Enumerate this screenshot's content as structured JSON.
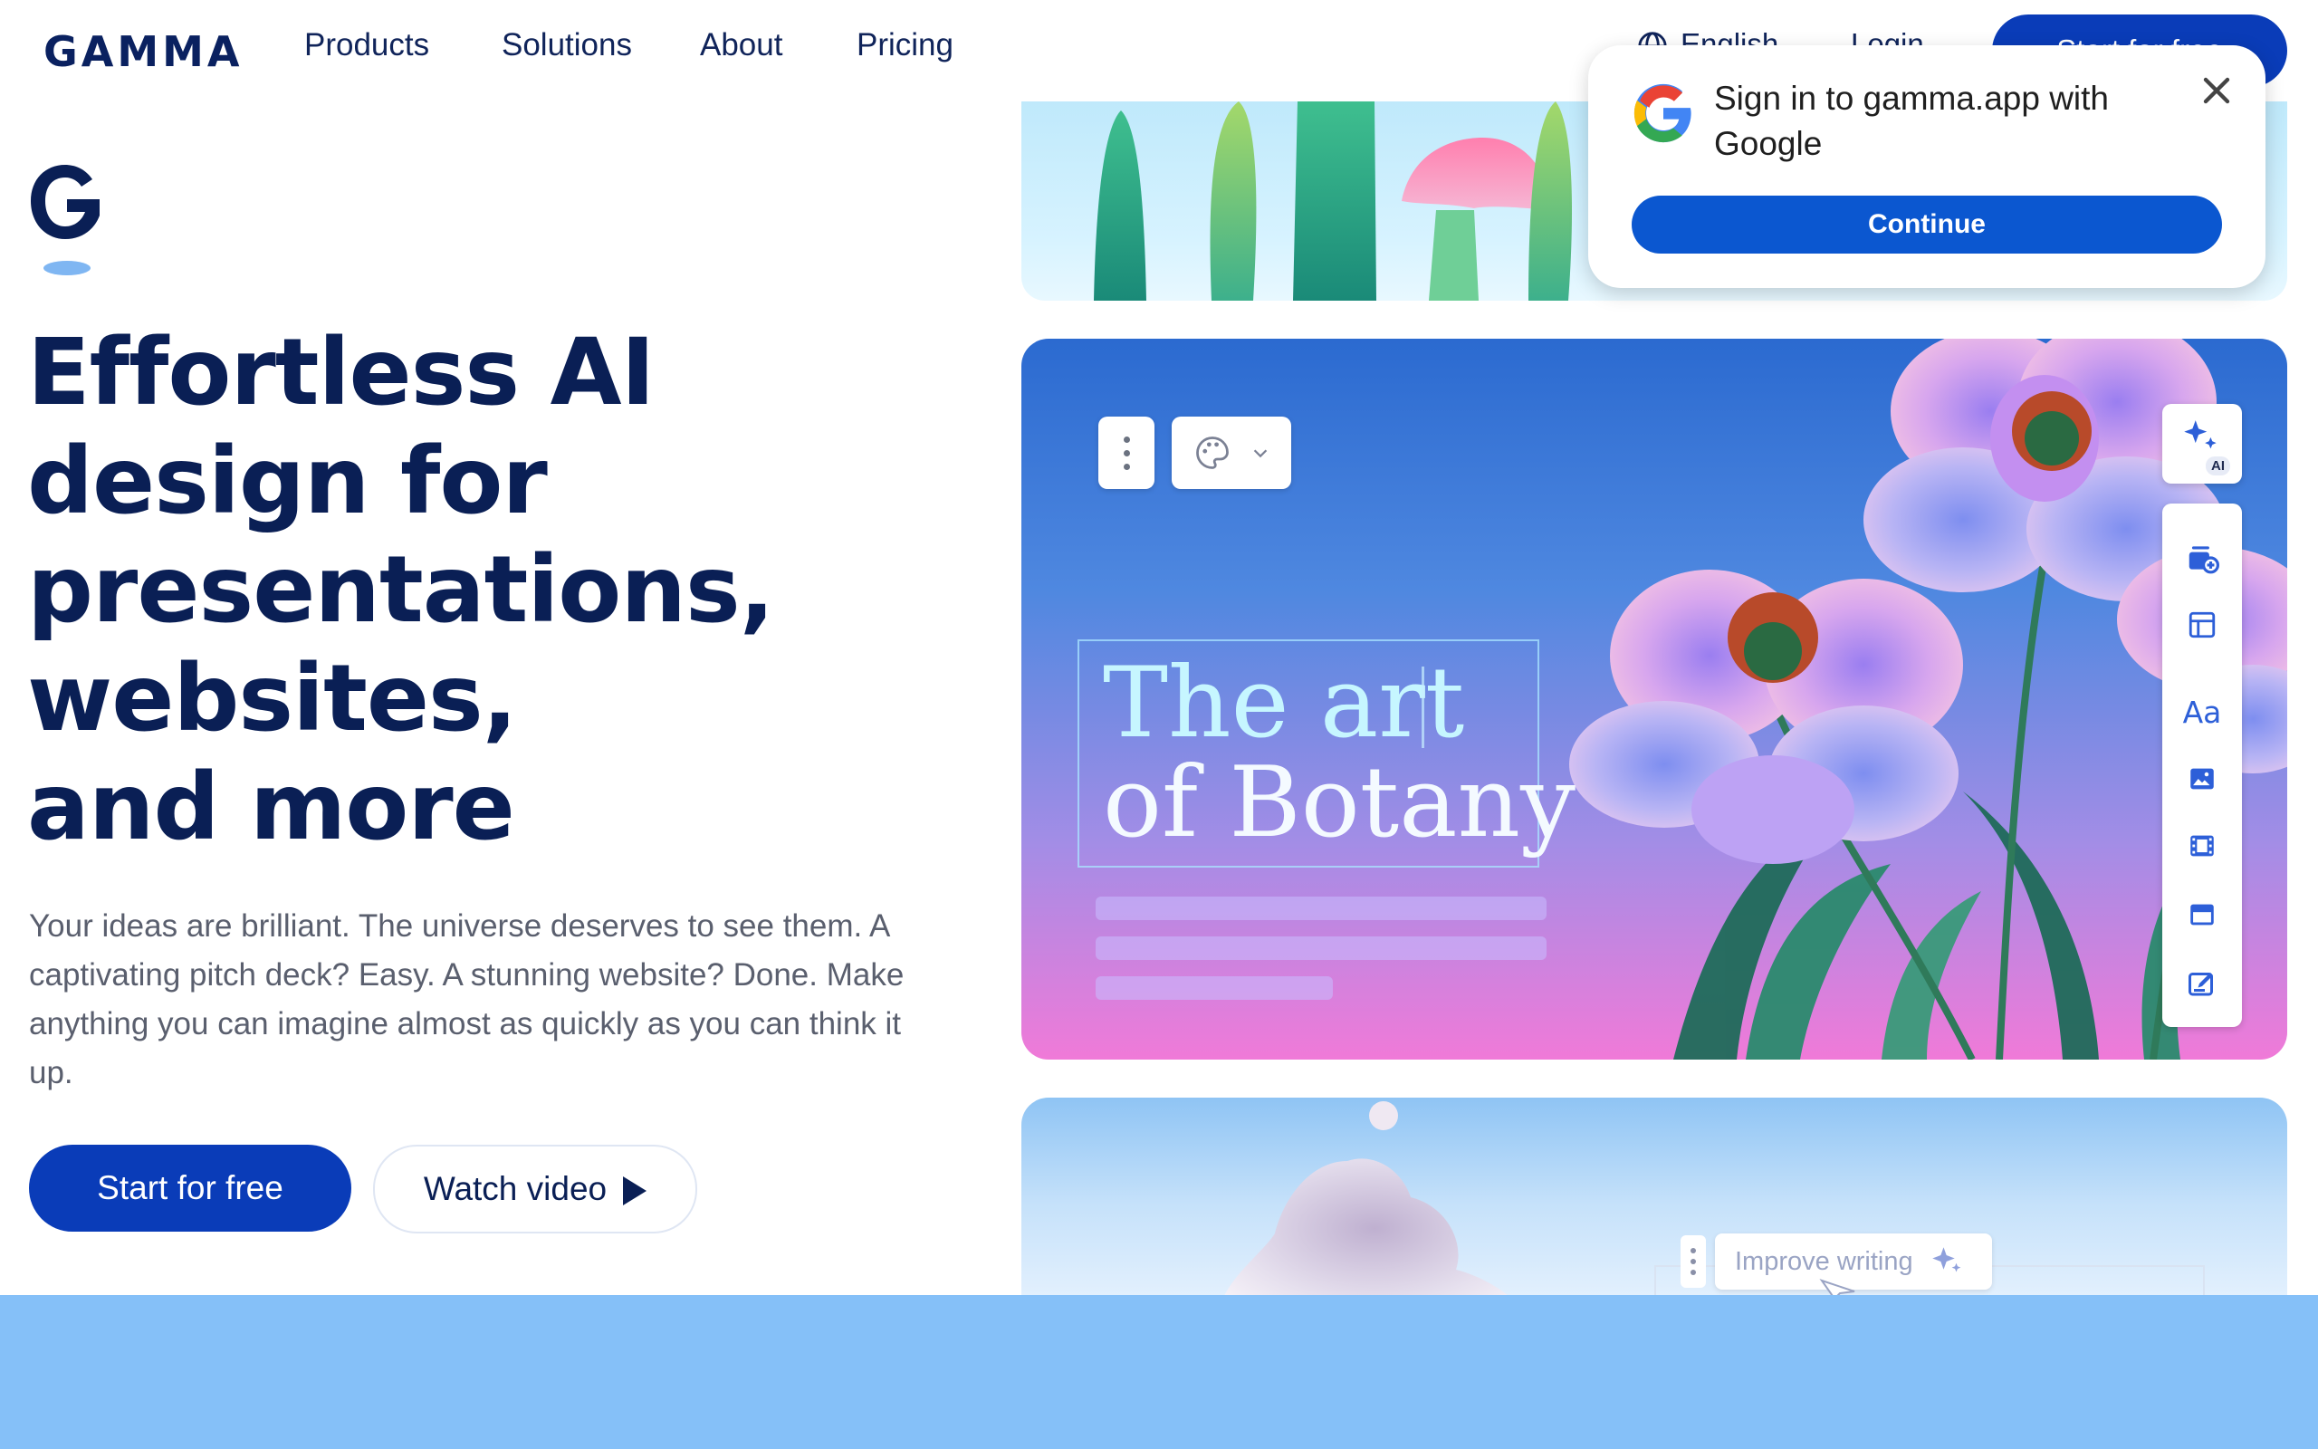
{
  "nav": {
    "logo": "GAMMA",
    "links": [
      "Products",
      "Solutions",
      "About",
      "Pricing"
    ],
    "language": "English",
    "login": "Login",
    "cta": "Start for free"
  },
  "hero": {
    "headline_lines": [
      "Effortless AI",
      "design for",
      "presentations,",
      "websites,",
      "and more"
    ],
    "subtext": "Your ideas are brilliant. The universe deserves to see them. A captivating pitch deck? Easy. A stunning website? Done. Make anything you can imagine almost as quickly as you can think it up.",
    "primary_button": "Start for free",
    "secondary_button": "Watch video"
  },
  "slide": {
    "title_line1": "The art",
    "title_line2": "of Botany",
    "ai_badge": "AI",
    "toolbar_icons": [
      "add-card-icon",
      "layout-icon",
      "text-icon",
      "image-icon",
      "video-icon",
      "embed-icon",
      "edit-icon"
    ]
  },
  "bottom_card": {
    "improve_label": "Improve writing"
  },
  "google_popup": {
    "title": "Sign in to gamma.app with Google",
    "button": "Continue"
  },
  "colors": {
    "brand_navy": "#0a1f55",
    "cta_blue": "#0a3cb8",
    "google_blue": "#0b57d0",
    "band_blue": "#85c0f8"
  }
}
